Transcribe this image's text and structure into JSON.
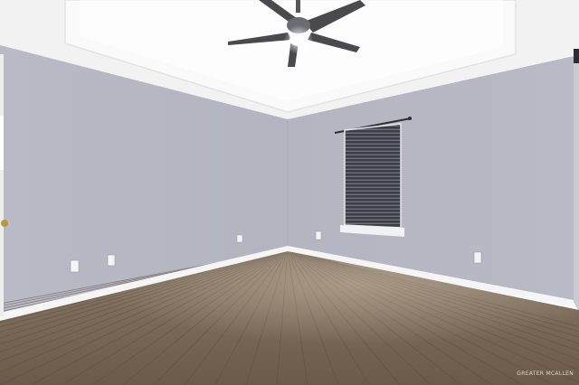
{
  "photo": {
    "subject": "empty-room",
    "colors": {
      "ceiling": "#f4f4f5",
      "ceiling_tray": "#fbfbfc",
      "left_wall": "#b6b7c3",
      "back_wall": "#b1b2be",
      "right_wall": "#c5c6d0",
      "baseboard": "#f7f7f7",
      "floor_base": "#7e6d5c",
      "floor_light": "#a39482",
      "floor_dark": "#5a4b3e",
      "blind_slat": "#3b3e45",
      "fan_blade": "#4a4a4e",
      "fan_light": "#ffffff"
    }
  },
  "watermark": {
    "text": "GREATER MCALLEN"
  }
}
